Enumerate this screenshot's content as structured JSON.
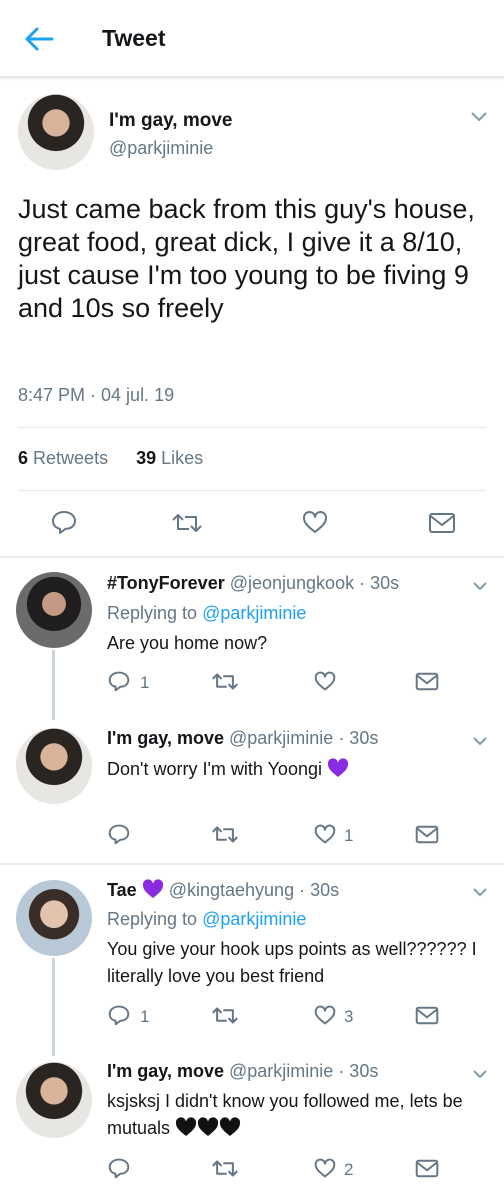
{
  "header": {
    "title": "Tweet"
  },
  "main_tweet": {
    "display_name": "I'm gay, move",
    "handle": "@parkjiminie",
    "text": "Just came back from this guy's house, great food, great dick, I give it a 8/10, just cause I'm too young to be fiving 9 and 10s so freely",
    "timestamp": "8:47 PM · 04 jul. 19",
    "retweets_count": "6",
    "retweets_label": "Retweets",
    "likes_count": "39",
    "likes_label": "Likes"
  },
  "replies": [
    {
      "display_name": "#TonyForever",
      "handle_meta": "@jeonjungkook · 30s",
      "replying_prefix": "Replying to",
      "replying_to": "@parkjiminie",
      "text": "Are you home now?",
      "reply_count": "1",
      "like_count": ""
    },
    {
      "display_name": "I'm gay, move",
      "handle_meta": "@parkjiminie · 30s",
      "text": "Don't worry I'm with Yoongi",
      "reply_count": "",
      "like_count": "1"
    },
    {
      "display_name": "Tae",
      "handle_meta": "@kingtaehyung · 30s",
      "replying_prefix": "Replying to",
      "replying_to": "@parkjiminie",
      "text": "You give your hook ups points as well?????? I literally love you best friend",
      "reply_count": "1",
      "like_count": "3"
    },
    {
      "display_name": "I'm gay, move",
      "handle_meta": "@parkjiminie · 30s",
      "text": "ksjsksj I didn't know you followed me, lets be mutuals",
      "reply_count": "",
      "like_count": "2"
    }
  ],
  "colors": {
    "accent": "#1da1f2",
    "muted": "#657786",
    "purple_heart": "#8a2be2",
    "black_heart": "#111111"
  },
  "icons": [
    "back-arrow-icon",
    "chevron-down-icon",
    "reply-icon",
    "retweet-icon",
    "like-icon",
    "share-icon",
    "purple-heart-emoji",
    "black-heart-emoji"
  ]
}
